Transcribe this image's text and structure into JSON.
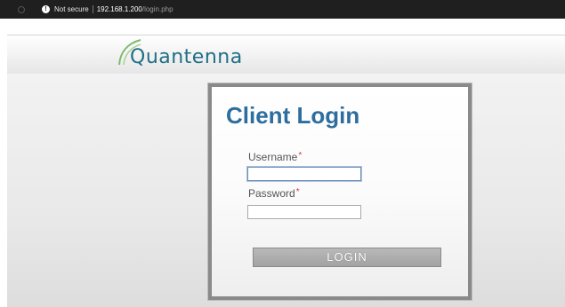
{
  "browser": {
    "security_text": "Not secure",
    "url_host": "192.168.1.200",
    "url_path": "/login.php"
  },
  "header": {
    "logo_text": "Quantenna"
  },
  "login": {
    "title": "Client Login",
    "username_label": "Username",
    "password_label": "Password",
    "required_marker": "*",
    "username_value": "",
    "password_value": "",
    "button_label": "LOGIN"
  },
  "icons": {
    "info": "info-icon",
    "logo_swoosh": "logo-swoosh-icon"
  },
  "colors": {
    "title": "#2d6e9e",
    "logo": "#1f6f86",
    "required": "#d23b3b",
    "button": "#a2a2a2"
  }
}
